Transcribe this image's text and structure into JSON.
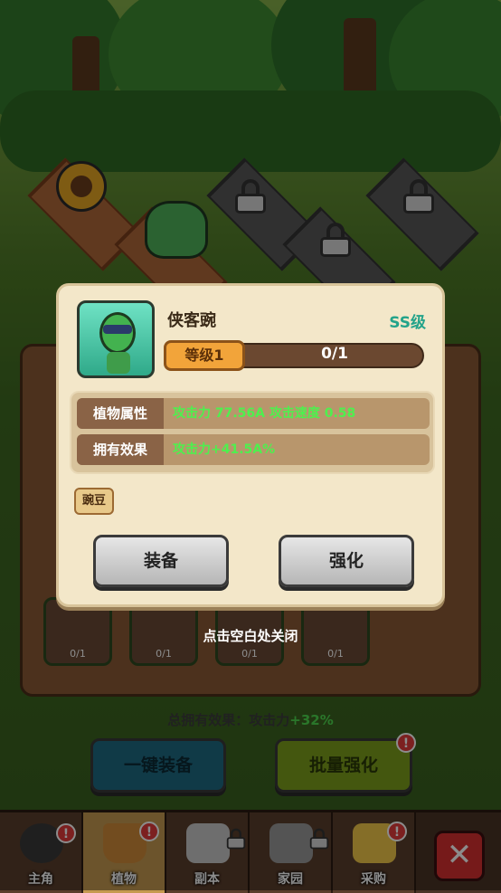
{
  "modal": {
    "plant_name": "侠客豌",
    "grade": "SS级",
    "level_label": "等级1",
    "progress_text": "0/1",
    "progress_fraction": 0,
    "stats": [
      {
        "label": "植物属性",
        "value": "攻击力 77.56A  攻击速度 0.58"
      },
      {
        "label": "拥有效果",
        "value": "攻击力+41.5A%"
      }
    ],
    "tag": "豌豆",
    "equip_label": "装备",
    "upgrade_label": "强化"
  },
  "close_hint": "点击空白处关闭",
  "background_cards": [
    {
      "count": "0/1"
    },
    {
      "count": "0/1"
    },
    {
      "count": "0/1"
    },
    {
      "count": "0/1"
    }
  ],
  "total_effect": {
    "prefix": "总拥有效果：攻击力",
    "value": "+32%"
  },
  "buttons": {
    "equip_all": "一键装备",
    "batch_upgrade": "批量强化",
    "badge": "!"
  },
  "nav": [
    {
      "label": "主角",
      "icon": "hero-icon",
      "badge": "!"
    },
    {
      "label": "植物",
      "icon": "plant-pot-icon",
      "badge": "!"
    },
    {
      "label": "副本",
      "icon": "map-icon",
      "locked": true
    },
    {
      "label": "家园",
      "icon": "house-icon",
      "locked": true
    },
    {
      "label": "采购",
      "icon": "cart-icon",
      "badge": "!"
    }
  ],
  "close_button": "✕",
  "colors": {
    "grade": "#23a38a",
    "stat_value": "#4ef04e",
    "level_pill": "#f2a43a"
  }
}
